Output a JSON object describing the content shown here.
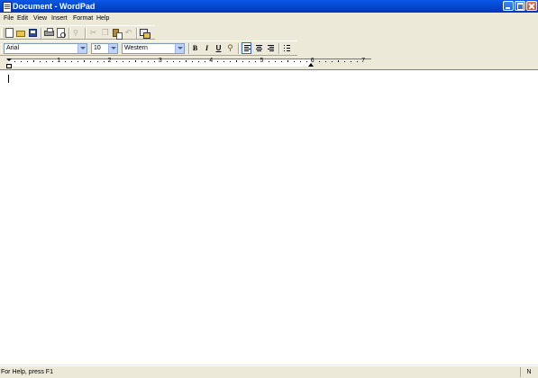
{
  "window": {
    "title": "Document - WordPad"
  },
  "menu": [
    "File",
    "Edit",
    "View",
    "Insert",
    "Format",
    "Help"
  ],
  "toolbar": {
    "buttons": [
      {
        "icon": "new-document-icon"
      },
      {
        "icon": "open-folder-icon"
      },
      {
        "icon": "save-icon"
      },
      {
        "icon": "print-icon"
      },
      {
        "icon": "print-preview-icon"
      },
      {
        "icon": "find-icon"
      },
      {
        "icon": "cut-icon"
      },
      {
        "icon": "copy-icon"
      },
      {
        "icon": "paste-icon"
      },
      {
        "icon": "undo-icon"
      },
      {
        "icon": "insert-object-icon"
      }
    ]
  },
  "format_bar": {
    "font": "Arial",
    "size": "10",
    "script": "Western",
    "bold": "B",
    "italic": "I",
    "underline": "U",
    "alignment": "left",
    "color_icon": "text-color-icon"
  },
  "ruler": {
    "numbers": [
      "1",
      "2",
      "3",
      "4",
      "5",
      "6",
      "7"
    ]
  },
  "statusbar": {
    "help_text": "For Help, press F1",
    "num_lock": "N"
  },
  "colors": {
    "titlebar": "#0a58e8",
    "face": "#ece9d8",
    "document": "#ffffff"
  }
}
